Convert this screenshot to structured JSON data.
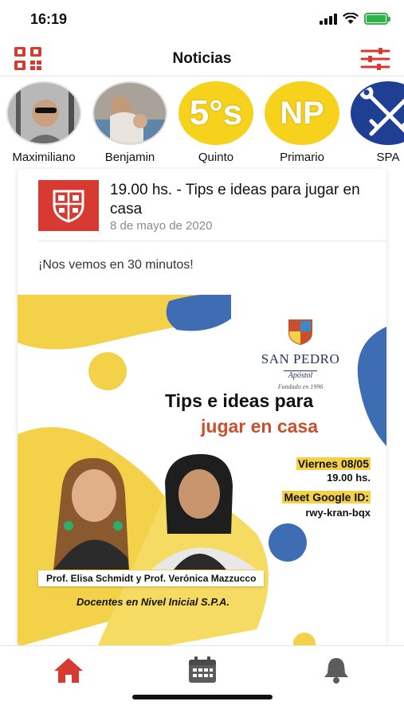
{
  "status_bar": {
    "time": "16:19"
  },
  "header": {
    "title": "Noticias",
    "left_icon": "qr-code-icon",
    "right_icon": "filter-sliders-icon",
    "accent_color": "#d63a31"
  },
  "stories": [
    {
      "label": "Maximiliano",
      "type": "photo"
    },
    {
      "label": "Benjamin",
      "type": "photo"
    },
    {
      "label": "Quinto",
      "type": "badge",
      "badge_text": "5°s",
      "badge_color": "#f6d21c"
    },
    {
      "label": "Primario",
      "type": "badge",
      "badge_text": "NP",
      "badge_color": "#f6d21c"
    },
    {
      "label": "SPA",
      "type": "badge",
      "badge_icon": "keys-icon",
      "badge_color": "#1f3f92"
    }
  ],
  "post": {
    "title": "19.00 hs. - Tips e ideas para jugar en casa",
    "date": "8 de mayo de 2020",
    "body": "¡Nos vemos en 30 minutos!",
    "poster": {
      "brand_name": "SAN PEDRO",
      "brand_sub": "Apóstol",
      "brand_founded": "Fundado en 1996",
      "title_line1": "Tips e ideas para",
      "title_line2": "jugar en casa",
      "event_day": "Viernes 08/05",
      "event_time": "19.00 hs.",
      "meet_label": "Meet Google ID:",
      "meet_id": "rwy-kran-bqx",
      "teachers": "Prof. Elisa Schmidt y Prof. Verónica Mazzucco",
      "role": "Docentes en Nivel Inicial S.P.A.",
      "colors": {
        "yellow": "#f3d24a",
        "blue": "#3f6db3",
        "orange": "#c9502e"
      }
    }
  },
  "bottom_nav": [
    {
      "icon": "home-icon",
      "active": true
    },
    {
      "icon": "calendar-icon",
      "active": false
    },
    {
      "icon": "bell-icon",
      "active": false
    }
  ]
}
